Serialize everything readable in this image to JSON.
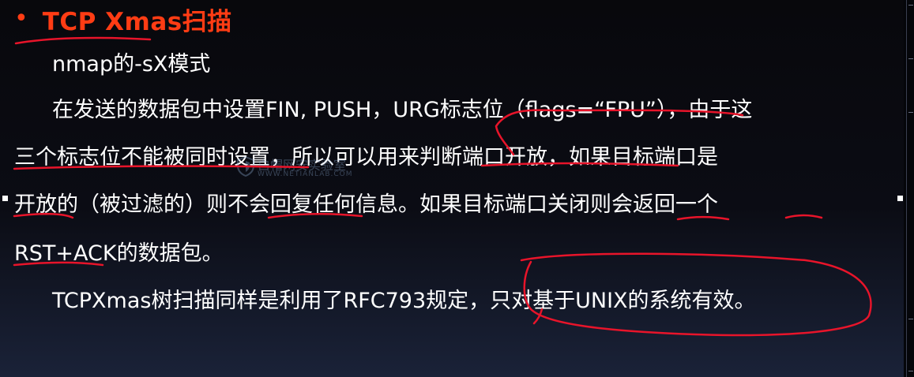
{
  "slide": {
    "title": "TCP Xmas扫描",
    "lines": [
      "nmap的-sX模式",
      "在发送的数据包中设置FIN, PUSH，URG标志位（flags=“FPU”），由于这",
      "三个标志位不能被同时设置，所以可以用来判断端口开放，如果目标端口是",
      "开放的（被过滤的）则不会回复任何信息。如果目标端口关闭则会返回一个",
      "RST+ACK的数据包。",
      "TCPXmas树扫描同样是利用了RFC793规定，只对基于UNIX的系统有效。"
    ],
    "watermark": {
      "text": "白帽网安实验室",
      "sub": "WWW.NETIANLAB.COM"
    }
  },
  "colors": {
    "title": "#ff3c14",
    "text": "#ffffff",
    "ink": "#e8142a",
    "background_top": "#08080c",
    "background_bottom": "#1a2238"
  }
}
